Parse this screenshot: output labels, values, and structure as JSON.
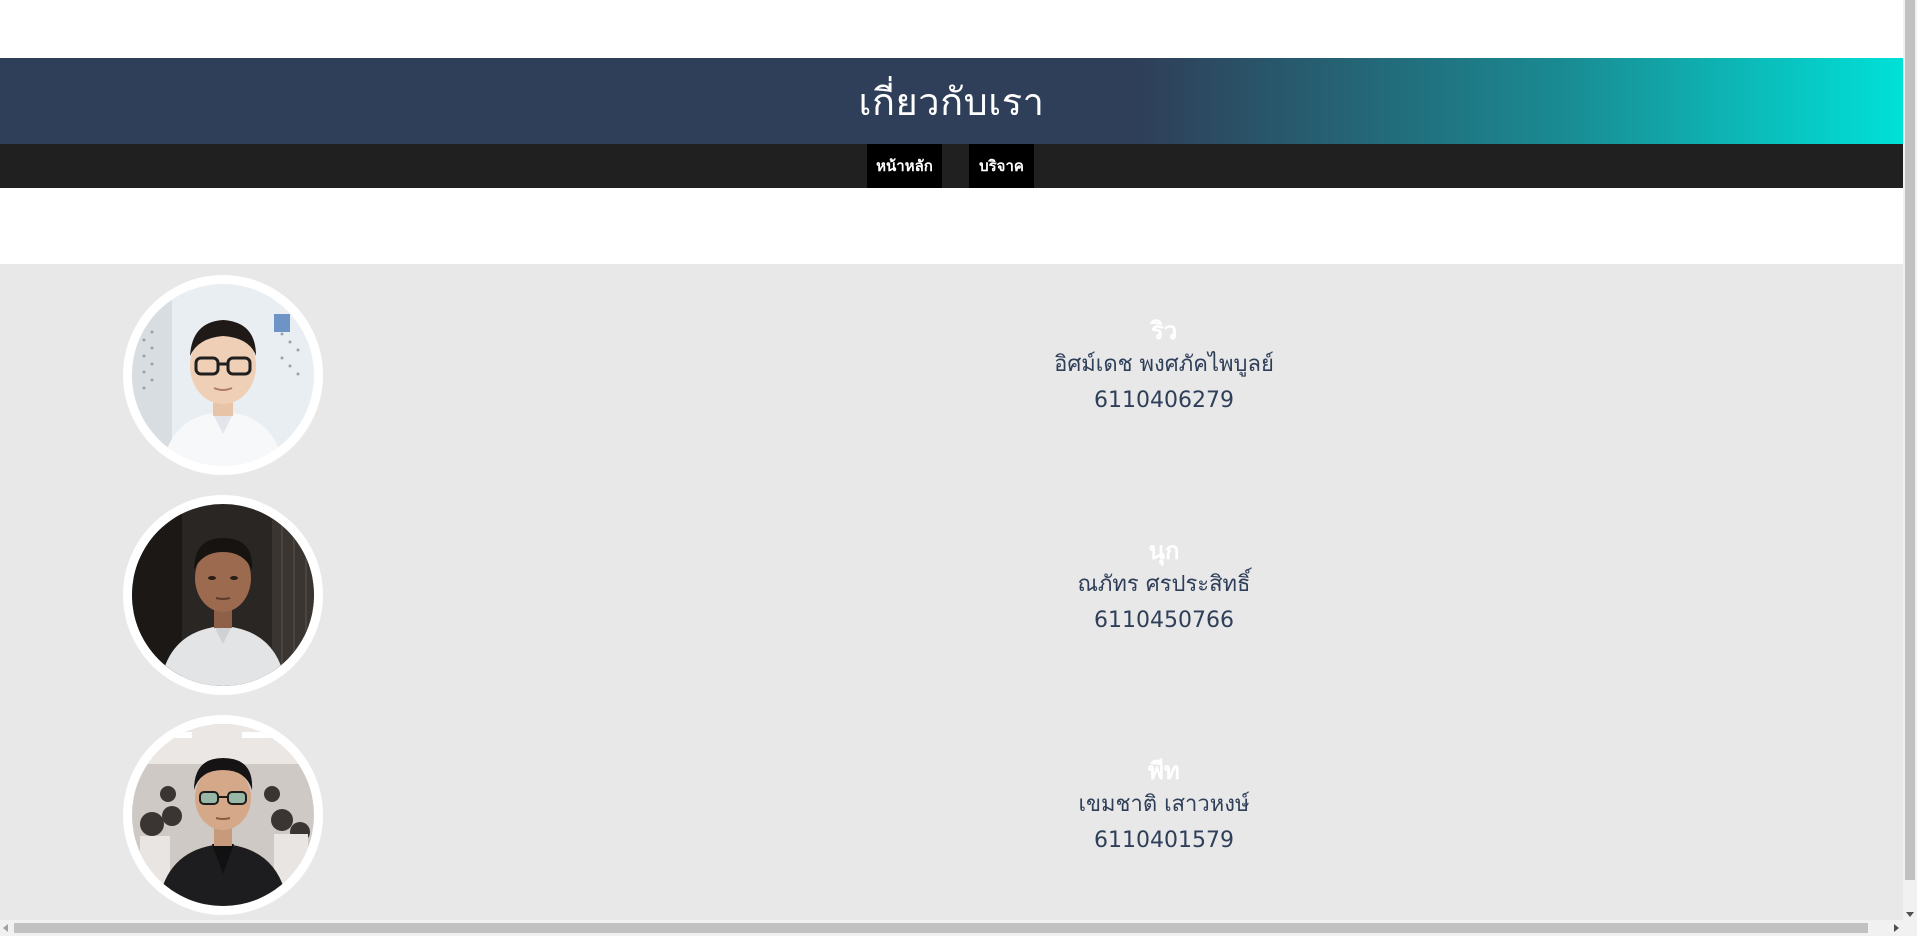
{
  "header": {
    "title": "เกี่ยวกับเรา",
    "gradient_start": "#2f3f59",
    "gradient_end": "#00e1d8"
  },
  "nav": {
    "items": [
      {
        "label": "หน้าหลัก"
      },
      {
        "label": "บริจาค"
      }
    ],
    "bar_color": "#202020",
    "item_color": "#000000"
  },
  "team": {
    "background": "#e8e8e8",
    "members": [
      {
        "nickname": "ริว",
        "fullname": "อิศม์เดช พงศภัคไพบูลย์",
        "student_id": "6110406279",
        "photo": "member-photo"
      },
      {
        "nickname": "นุก",
        "fullname": "ณภัทร ศรประสิทธิ์",
        "student_id": "6110450766",
        "photo": "member-photo"
      },
      {
        "nickname": "พีท",
        "fullname": "เขมชาติ เสาวหงษ์",
        "student_id": "6110401579",
        "photo": "member-photo"
      }
    ]
  },
  "colors": {
    "nickname": "#ffffff",
    "text": "#2f3f59"
  }
}
